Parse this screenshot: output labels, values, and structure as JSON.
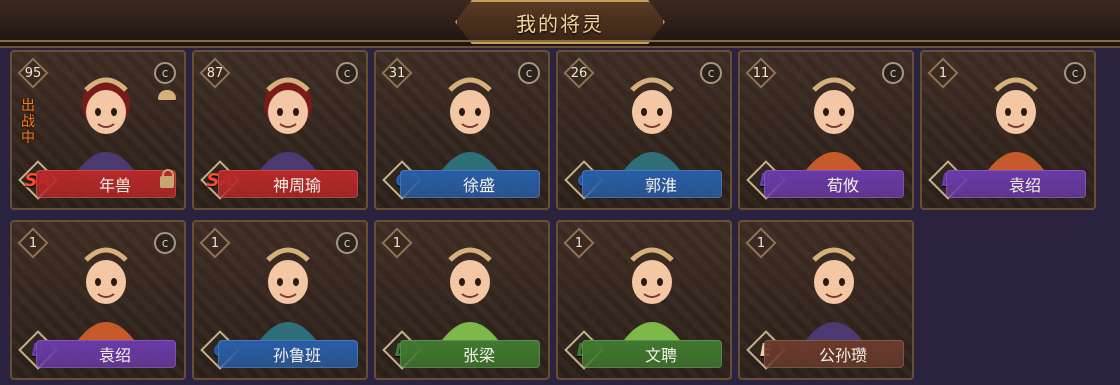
{
  "header": {
    "title": "我的将灵"
  },
  "colors": {
    "SA": "#b82828",
    "C": "#285ea8",
    "B": "#6a3aa8",
    "D": "#3f7a2f",
    "E": "#6b3a2c"
  },
  "cards": [
    {
      "level": "95",
      "grade": "SA",
      "name": "年兽",
      "status": "出战中",
      "locked": true,
      "hat_icon": true
    },
    {
      "level": "87",
      "grade": "SA",
      "name": "神周瑜"
    },
    {
      "level": "31",
      "grade": "C",
      "name": "徐盛"
    },
    {
      "level": "26",
      "grade": "C",
      "name": "郭淮"
    },
    {
      "level": "11",
      "grade": "B",
      "name": "荀攸"
    },
    {
      "level": "1",
      "grade": "B",
      "name": "袁绍"
    },
    {
      "level": "1",
      "grade": "B",
      "name": "袁绍"
    },
    {
      "level": "1",
      "grade": "C",
      "name": "孙鲁班"
    },
    {
      "level": "1",
      "grade": "D",
      "name": "张梁"
    },
    {
      "level": "1",
      "grade": "D",
      "name": "文聘"
    },
    {
      "level": "1",
      "grade": "E",
      "name": "公孙瓒"
    }
  ],
  "icons": {
    "coin": "c-coin-icon",
    "lock": "lock-icon",
    "hat": "hat-icon"
  }
}
